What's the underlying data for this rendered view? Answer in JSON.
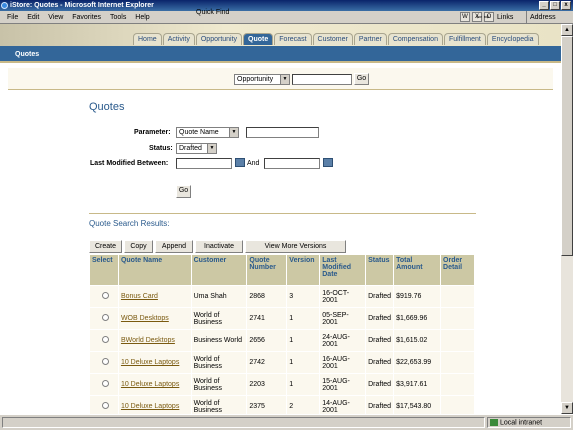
{
  "window": {
    "title": "iStore: Quotes - Microsoft Internet Explorer",
    "min_label": "_",
    "max_label": "□",
    "close_label": "x"
  },
  "menubar": {
    "items": [
      "File",
      "Edit",
      "View",
      "Favorites",
      "Tools",
      "Help"
    ],
    "links_label": "Links",
    "address_label": "Address"
  },
  "tabs": [
    "Home",
    "Activity",
    "Opportunity",
    "Quote",
    "Forecast",
    "Customer",
    "Partner",
    "Compensation",
    "Fulfillment",
    "Encyclopedia"
  ],
  "active_tab": "Quote",
  "subnav": {
    "title": "Quotes"
  },
  "quick_find": {
    "label": "Quick Find",
    "selected": "Opportunity",
    "input_value": "",
    "go_label": "Go"
  },
  "form": {
    "title": "Quotes",
    "parameter_label": "Parameter:",
    "parameter_value": "Quote Name",
    "parameter_input": "",
    "status_label": "Status:",
    "status_value": "Drafted",
    "modified_label": "Last Modified Between:",
    "and_label": "And",
    "go_label": "Go"
  },
  "results": {
    "title": "Quote Search Results:",
    "actions": [
      "Create",
      "Copy",
      "Append",
      "Inactivate",
      "View More Versions"
    ],
    "columns": [
      "Select",
      "Quote Name",
      "Customer",
      "Quote Number",
      "Version",
      "Last Modified Date",
      "Status",
      "Total Amount",
      "Order Detail"
    ],
    "rows": [
      {
        "name": "Bonus Card",
        "customer": "Uma Shah",
        "number": "2868",
        "version": "3",
        "date": "16-OCT-2001",
        "status": "Drafted",
        "amount": "$919.76",
        "detail": ""
      },
      {
        "name": "WOB Desktops",
        "customer": "World of Business",
        "number": "2741",
        "version": "1",
        "date": "05-SEP-2001",
        "status": "Drafted",
        "amount": "$1,669.96",
        "detail": ""
      },
      {
        "name": "BWorld Desktops",
        "customer": "Business World",
        "number": "2656",
        "version": "1",
        "date": "24-AUG-2001",
        "status": "Drafted",
        "amount": "$1,615.02",
        "detail": ""
      },
      {
        "name": "10 Deluxe Laptops",
        "customer": "World of Business",
        "number": "2742",
        "version": "1",
        "date": "16-AUG-2001",
        "status": "Drafted",
        "amount": "$22,653.99",
        "detail": ""
      },
      {
        "name": "10 Deluxe Laptops",
        "customer": "World of Business",
        "number": "2203",
        "version": "1",
        "date": "15-AUG-2001",
        "status": "Drafted",
        "amount": "$3,917.61",
        "detail": ""
      },
      {
        "name": "10 Deluxe Laptops",
        "customer": "World of Business",
        "number": "2375",
        "version": "2",
        "date": "14-AUG-2001",
        "status": "Drafted",
        "amount": "$17,543.80",
        "detail": ""
      }
    ]
  },
  "statusbar": {
    "zone": "Local intranet"
  }
}
